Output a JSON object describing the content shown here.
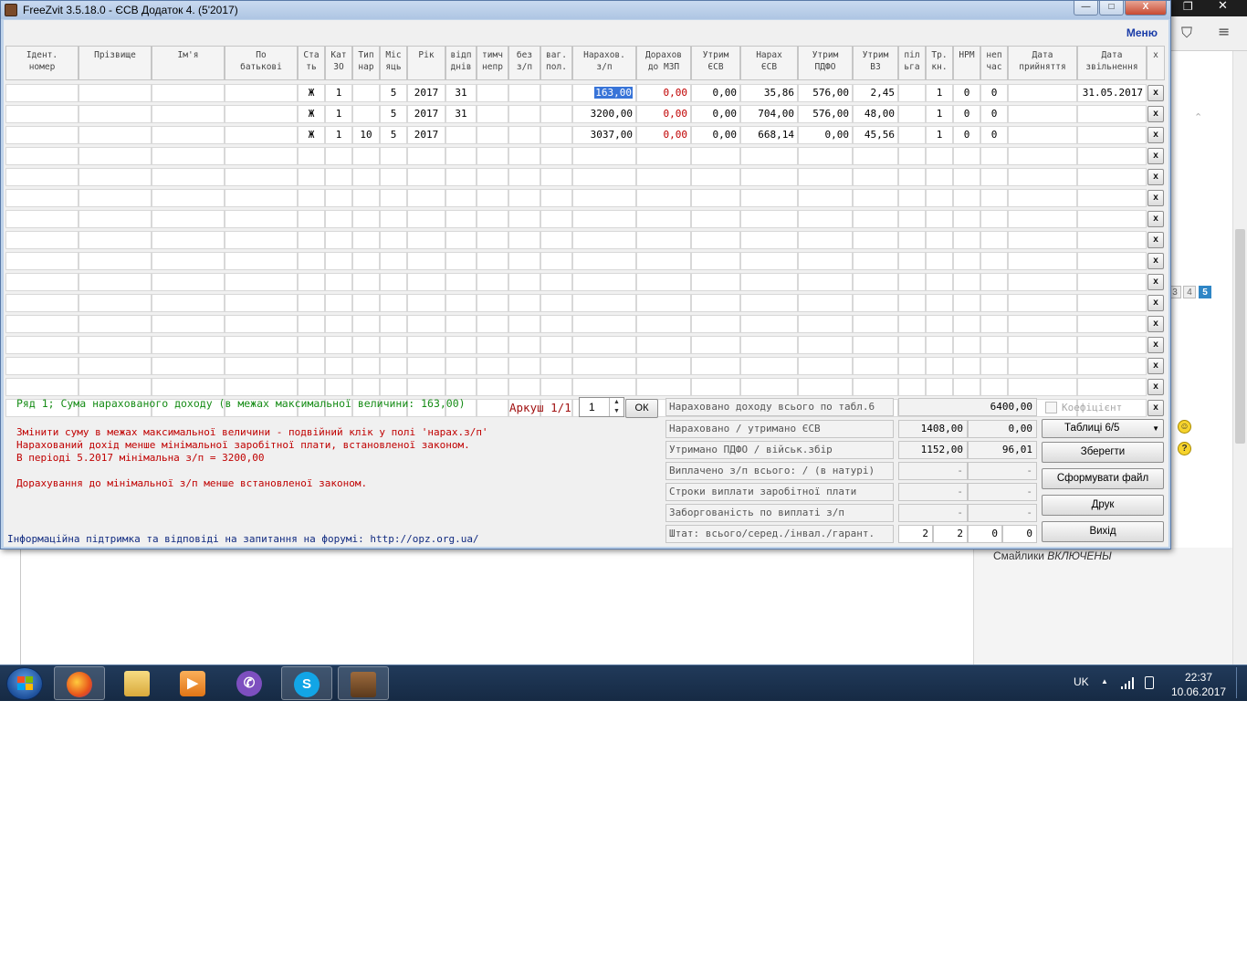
{
  "window": {
    "title": "FreeZvit 3.5.18.0 - ЄСВ Додаток 4. (5'2017)",
    "menu_label": "Меню",
    "minimize_glyph": "—",
    "maximize_glyph": "□",
    "close_glyph": "X"
  },
  "grid": {
    "headers": [
      "Ідент.\nномер",
      "Прізвище",
      "Ім'я",
      "По\nбатькові",
      "Ста\nть",
      "Кат\nЗО",
      "Тип\nнар",
      "Міс\nяць",
      "Рік",
      "відп\nднів",
      "тимч\nнепр",
      "без\nз/п",
      "ваг.\nпол.",
      "Нарахов.\nз/п",
      "Дорахов\nдо МЗП",
      "Утрим\nЄСВ",
      "Нарах\nЄСВ",
      "Утрим\nПДФО",
      "Утрим\nВЗ",
      "піл\nьга",
      "Тр.\nкн.",
      "НРМ",
      "неп\nчас",
      "Дата\nприйняття",
      "Дата\nзвільнення",
      "x"
    ],
    "rows": [
      [
        "",
        "",
        "",
        "",
        "Ж",
        "1",
        "",
        "5",
        "2017",
        "31",
        "",
        "",
        "",
        "163,00",
        "0,00",
        "0,00",
        "35,86",
        "576,00",
        "2,45",
        "",
        "1",
        "0",
        "0",
        "",
        "31.05.2017"
      ],
      [
        "",
        "",
        "",
        "",
        "Ж",
        "1",
        "",
        "5",
        "2017",
        "31",
        "",
        "",
        "",
        "3200,00",
        "0,00",
        "0,00",
        "704,00",
        "576,00",
        "48,00",
        "",
        "1",
        "0",
        "0",
        "",
        ""
      ],
      [
        "",
        "",
        "",
        "",
        "Ж",
        "1",
        "10",
        "5",
        "2017",
        "",
        "",
        "",
        "",
        "3037,00",
        "0,00",
        "0,00",
        "668,14",
        "0,00",
        "45,56",
        "",
        "1",
        "0",
        "0",
        "",
        ""
      ]
    ],
    "empty_row_count": 13,
    "delete_button_label": "x"
  },
  "status": {
    "row_info": "Ряд 1; Сума нарахованого доходу (в межах максимальної величини: 163,00)",
    "messages": [
      "Змінити суму в межах максимальної величини - подвійний клік у полі 'нарах.з/п'",
      "Нарахований дохід менше мінімальної заробітної плати, встановленої законом.",
      "В періоді 5.2017 мінімальна з/п = 3200,00",
      "",
      "Дорахування до мінімальної з/п менше встановленої законом."
    ],
    "support": "Інформаційна підтримка та відповіді на запитання на форумі: http://opz.org.ua/"
  },
  "sheet": {
    "label": "Аркуш 1/1",
    "value": "1",
    "ok_label": "ОК",
    "spin_up": "▲",
    "spin_down": "▼"
  },
  "summary": {
    "income_label": "Нараховано доходу всього по табл.6",
    "income_value": "6400,00",
    "esv_label": "Нараховано / утримано ЄСВ",
    "esv_accrued": "1408,00",
    "esv_withheld": "0,00",
    "pdfo_label": "Утримано ПДФО / військ.збір",
    "pdfo_value": "1152,00",
    "military_value": "96,01",
    "paid_label": "Виплачено з/п всього: / (в натурі)",
    "paid_value": "-",
    "paid_kind_value": "-",
    "terms_label": "Строки виплати заробітної плати",
    "terms_value_1": "-",
    "terms_value_2": "-",
    "debt_label": "Заборгованість по виплаті з/п",
    "debt_value_1": "-",
    "debt_value_2": "-",
    "staff_label": "Штат: всього/серед./інвал./гарант.",
    "staff_values": [
      "2",
      "2",
      "0",
      "0"
    ]
  },
  "actions": {
    "coefficient_label": "Коефіцієнт",
    "tables_label": "Таблиці 6/5",
    "save_label": "Зберегти",
    "build_file_label": "Сформувати файл",
    "print_label": "Друк",
    "exit_label": "Вихід"
  },
  "background": {
    "smiles_prefix": "Смайлики",
    "smiles_state": "ВКЛЮЧЕНЫ",
    "pages": [
      "3",
      "4",
      "5"
    ],
    "emoji_help": "?"
  },
  "taskbar": {
    "apps": [
      "firefox-icon",
      "file-explorer-icon",
      "media-player-icon",
      "viber-icon",
      "skype-icon",
      "freezvit-icon"
    ],
    "language": "UK",
    "time": "22:37",
    "date": "10.06.2017"
  },
  "colors": {
    "error_text": "#c00000",
    "status_text": "#168c16",
    "selection": "#3874d8",
    "link": "#1a3ca8"
  }
}
